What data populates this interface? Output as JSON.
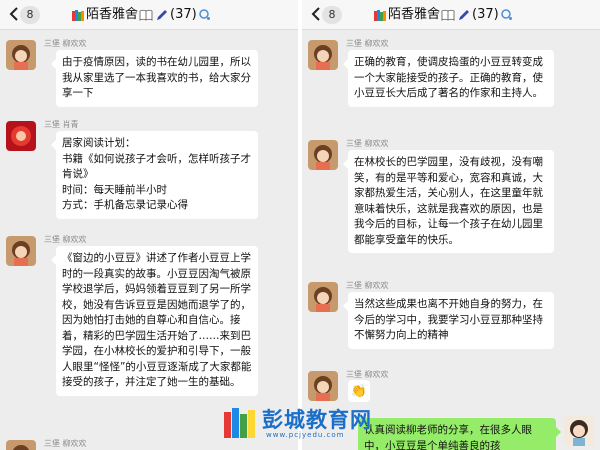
{
  "screens": [
    {
      "header": {
        "badge": "8",
        "title_prefix": "陌香雅舍",
        "member_count": "(37)"
      },
      "messages": [
        {
          "sender": "三堡  柳欢欢",
          "text": "由于疫情原因，读的书在幼儿园里，所以我从家里选了一本我喜欢的书，给大家分享一下"
        },
        {
          "sender": "三堡  肖青",
          "text": "居家阅读计划：\n书籍《如何说孩子才会听，怎样听孩子才肯说》\n时间：每天睡前半小时\n方式：手机备忘录记录心得"
        },
        {
          "sender": "三堡  柳欢欢",
          "text": "《窗边的小豆豆》讲述了作者小豆豆上学时的一段真实的故事。小豆豆因淘气被原学校退学后，妈妈领着豆豆到了另一所学校，她没有告诉豆豆是因她而退学了的，因为她怕打击她的自尊心和自信心。接着，精彩的巴学园生活开始了……来到巴学园，在小林校长的爱护和引导下，一般人眼里“怪怪”的小豆豆逐渐成了大家都能接受的孩子，并注定了她一生的基础。"
        },
        {
          "sender": "三堡  柳欢欢"
        }
      ]
    },
    {
      "header": {
        "badge": "8",
        "title_prefix": "陌香雅舍",
        "member_count": "(37)"
      },
      "messages": [
        {
          "sender": "三堡  柳欢欢",
          "text": "正确的教育，使调皮捣蛋的小豆豆转变成一个大家能接受的孩子。正确的教育，使小豆豆长大后成了著名的作家和主持人。"
        },
        {
          "sender": "三堡  柳欢欢",
          "text": "在林校长的巴学园里，没有歧视，没有嘲笑，有的是平等和爱心，宽容和真诚，大家都热爱生活，关心别人，在这里童年就意味着快乐，这就是我喜欢的原因，也是我今后的目标，让每一个孩子在幼儿园里都能享受童年的快乐。"
        },
        {
          "sender": "三堡  柳欢欢",
          "text": "当然这些成果也离不开她自身的努力，在今后的学习中，我要学习小豆豆那种坚持不懈努力向上的精神"
        },
        {
          "sender": "三堡  柳欢欢",
          "sticker": "👏"
        },
        {
          "text": "认真阅读柳老师的分享，在很多人眼中，小豆豆是个单纯善良的孩"
        }
      ]
    }
  ],
  "watermark": {
    "name": "彭城教育网",
    "url": "www.pcjyedu.com"
  }
}
